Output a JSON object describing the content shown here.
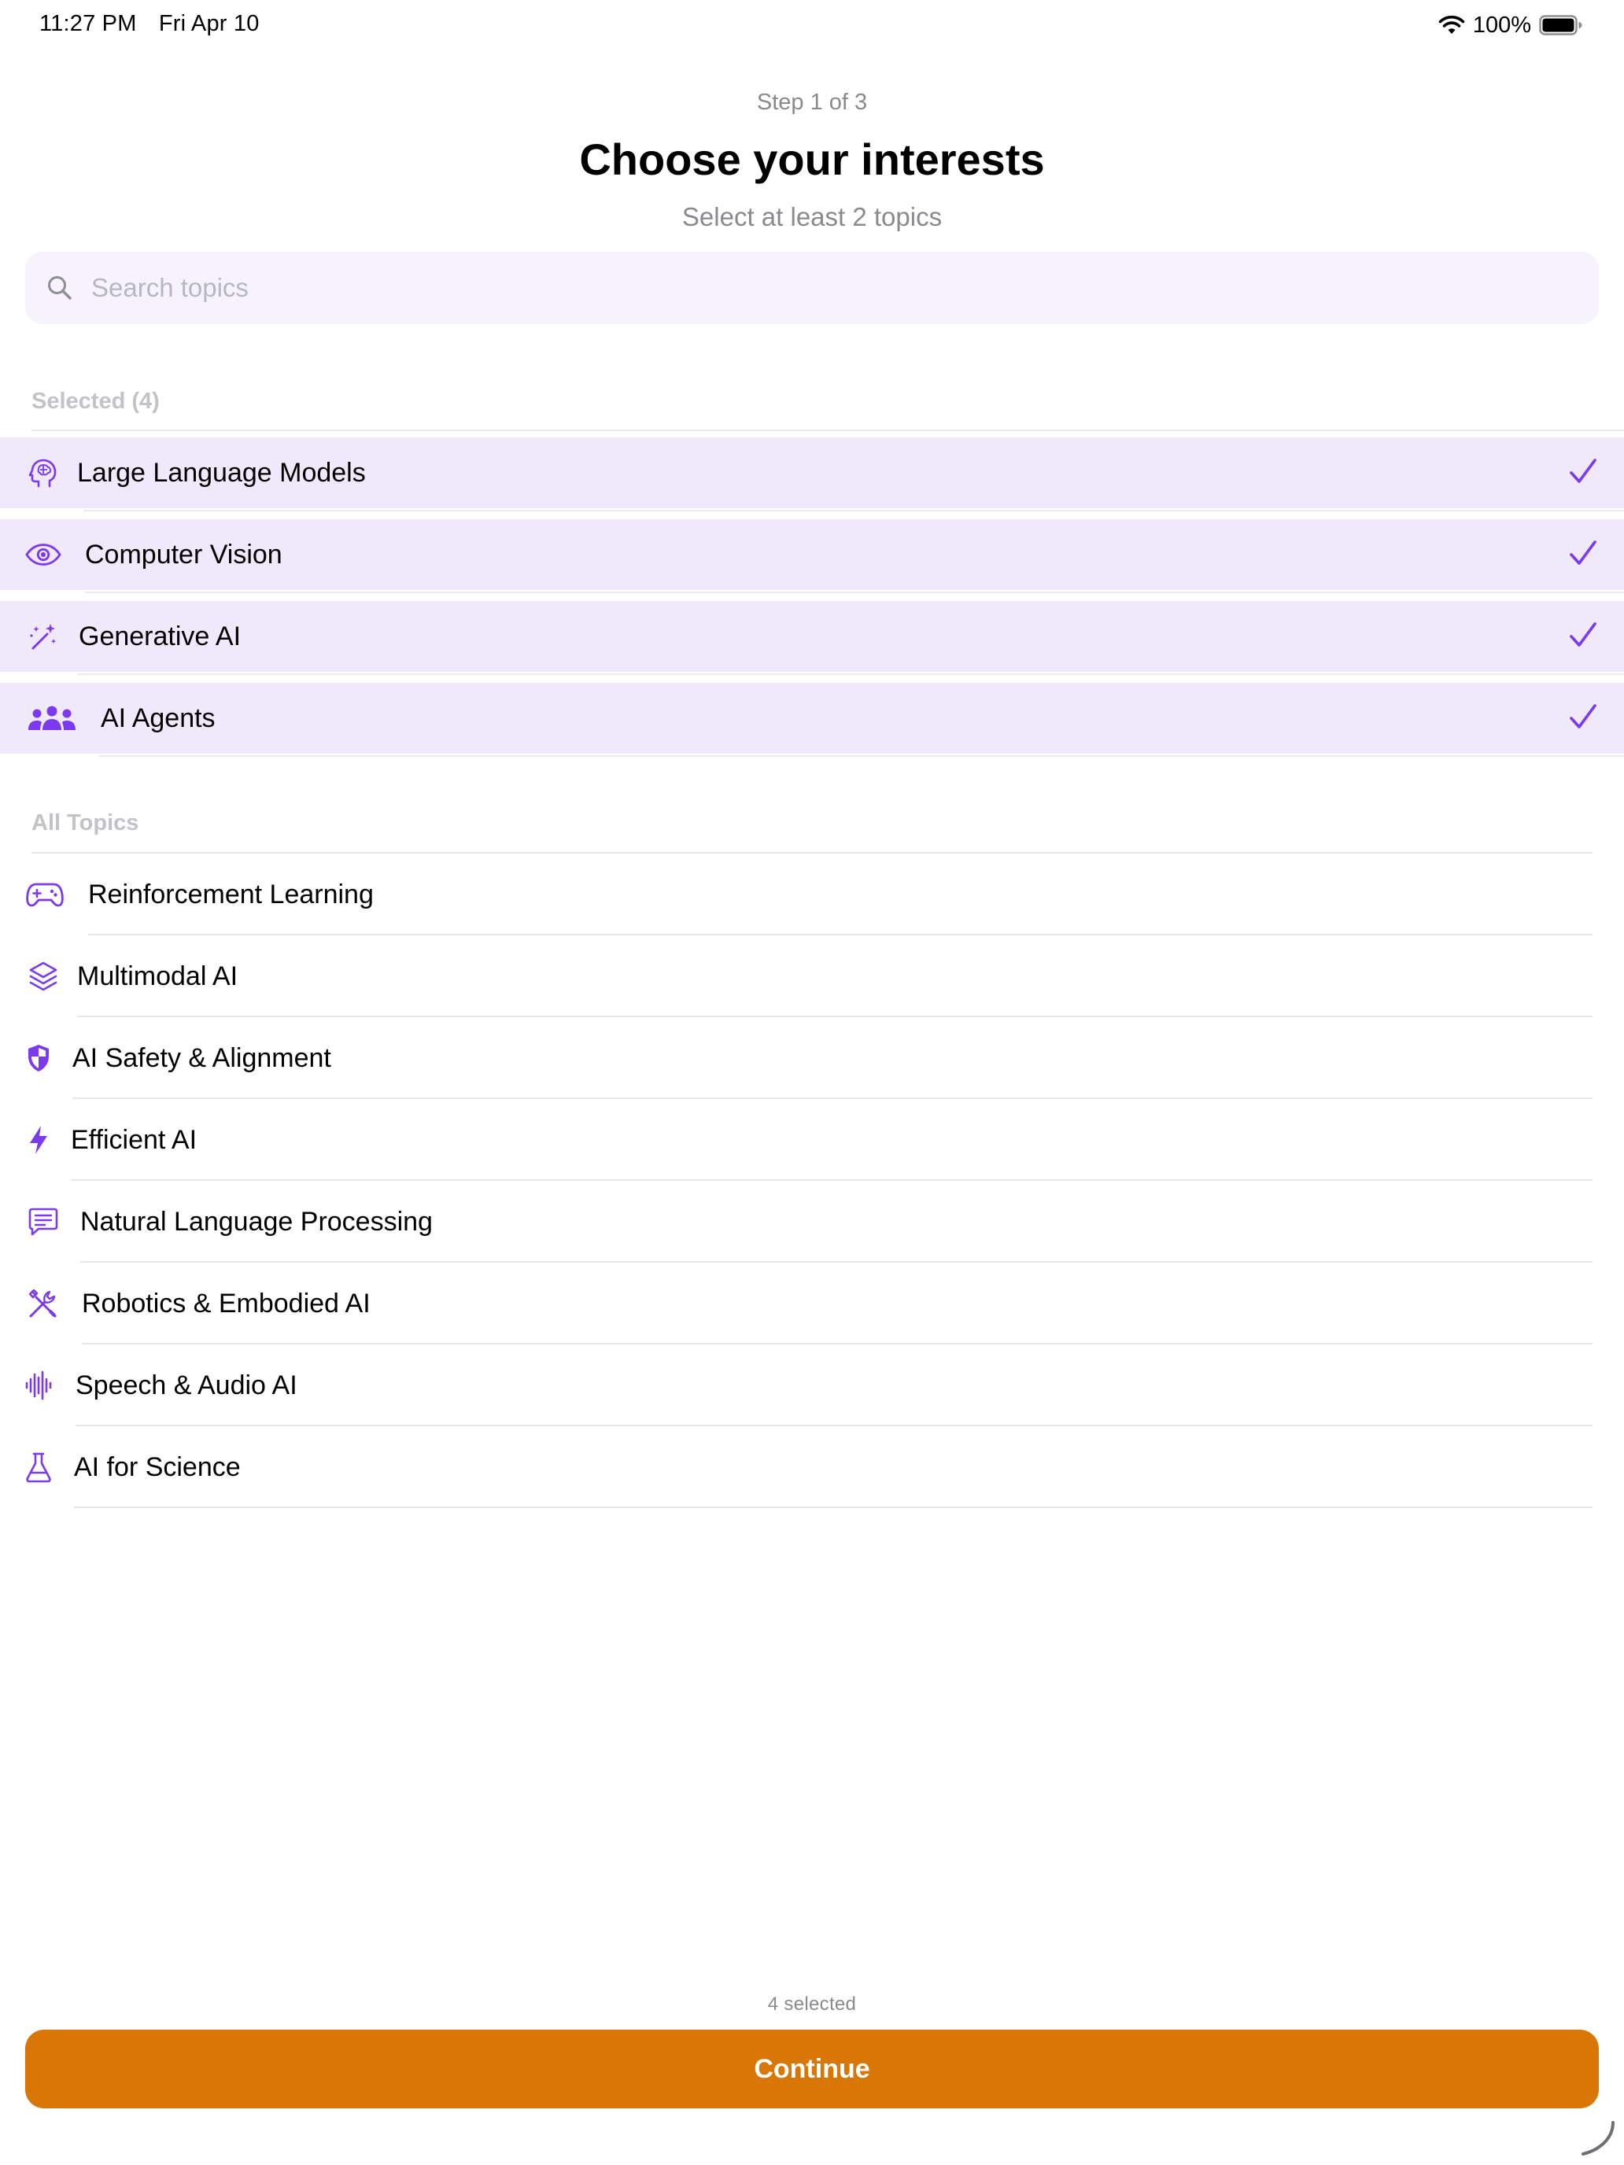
{
  "status_bar": {
    "time": "11:27 PM",
    "date": "Fri Apr 10",
    "battery": "100%"
  },
  "header": {
    "step": "Step 1 of 3",
    "title": "Choose your interests",
    "subtitle": "Select at least 2 topics"
  },
  "search": {
    "placeholder": "Search topics",
    "value": ""
  },
  "selected_section": {
    "label": "Selected (4)",
    "items": [
      {
        "label": "Large Language Models",
        "icon": "brain-head-icon"
      },
      {
        "label": "Computer Vision",
        "icon": "eye-icon"
      },
      {
        "label": "Generative AI",
        "icon": "magic-wand-icon"
      },
      {
        "label": "AI Agents",
        "icon": "people-group-icon"
      }
    ]
  },
  "all_section": {
    "label": "All Topics",
    "items": [
      {
        "label": "Reinforcement Learning",
        "icon": "gamepad-icon"
      },
      {
        "label": "Multimodal AI",
        "icon": "layers-icon"
      },
      {
        "label": "AI Safety & Alignment",
        "icon": "shield-icon"
      },
      {
        "label": "Efficient AI",
        "icon": "bolt-icon"
      },
      {
        "label": "Natural Language Processing",
        "icon": "chat-bubble-icon"
      },
      {
        "label": "Robotics & Embodied AI",
        "icon": "tools-icon"
      },
      {
        "label": "Speech & Audio AI",
        "icon": "waveform-icon"
      },
      {
        "label": "AI for Science",
        "icon": "flask-icon"
      }
    ]
  },
  "footer": {
    "count": "4 selected",
    "continue_label": "Continue"
  },
  "colors": {
    "accent": "#7c3aed",
    "selected_bg": "#f0e9fc",
    "button": "#d97706"
  }
}
